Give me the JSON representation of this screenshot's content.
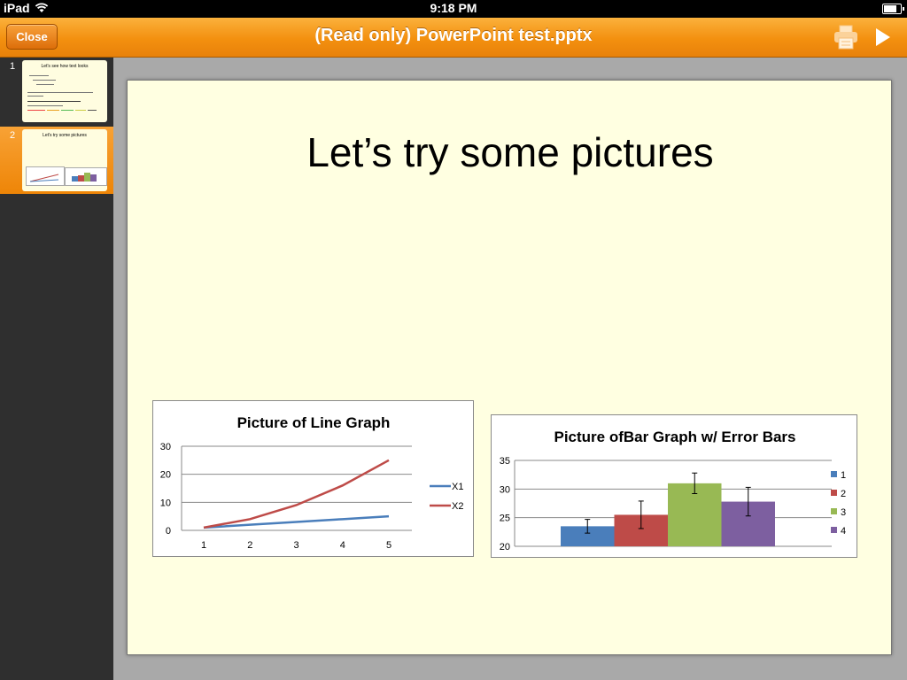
{
  "status_bar": {
    "device": "iPad",
    "time": "9:18 PM",
    "battery_level": 0.9
  },
  "toolbar": {
    "close_label": "Close",
    "title": "(Read only) PowerPoint test.pptx",
    "print_icon": "print-icon",
    "play_icon": "play-icon"
  },
  "thumbnails": [
    {
      "number": "1",
      "title": "Let's see how text looks",
      "selected": false
    },
    {
      "number": "2",
      "title": "Let's try some pictures",
      "selected": true
    }
  ],
  "slide": {
    "title": "Let’s try some pictures"
  },
  "chart_data": [
    {
      "type": "line",
      "title": "Picture of Line Graph",
      "xlabel": "",
      "ylabel": "",
      "x": [
        1,
        2,
        3,
        4,
        5
      ],
      "ylim": [
        0,
        30
      ],
      "yticks": [
        0,
        10,
        20,
        30
      ],
      "grid": true,
      "legend": "right",
      "series": [
        {
          "name": "X1",
          "color": "#4a7ebb",
          "values": [
            1,
            2,
            3,
            4,
            5
          ]
        },
        {
          "name": "X2",
          "color": "#be4b48",
          "values": [
            1,
            4,
            9,
            16,
            25
          ]
        }
      ]
    },
    {
      "type": "bar",
      "title": "Picture ofBar Graph w/ Error Bars",
      "xlabel": "",
      "ylabel": "",
      "ylim": [
        20,
        35
      ],
      "yticks": [
        20,
        25,
        30,
        35
      ],
      "grid": true,
      "legend": "right",
      "series": [
        {
          "name": "1",
          "color": "#4a7ebb",
          "value": 23.5,
          "error": 1.2
        },
        {
          "name": "2",
          "color": "#be4b48",
          "value": 25.5,
          "error": 2.4
        },
        {
          "name": "3",
          "color": "#98b954",
          "value": 31,
          "error": 1.8
        },
        {
          "name": "4",
          "color": "#7d5fa0",
          "value": 27.8,
          "error": 2.5
        }
      ]
    }
  ]
}
